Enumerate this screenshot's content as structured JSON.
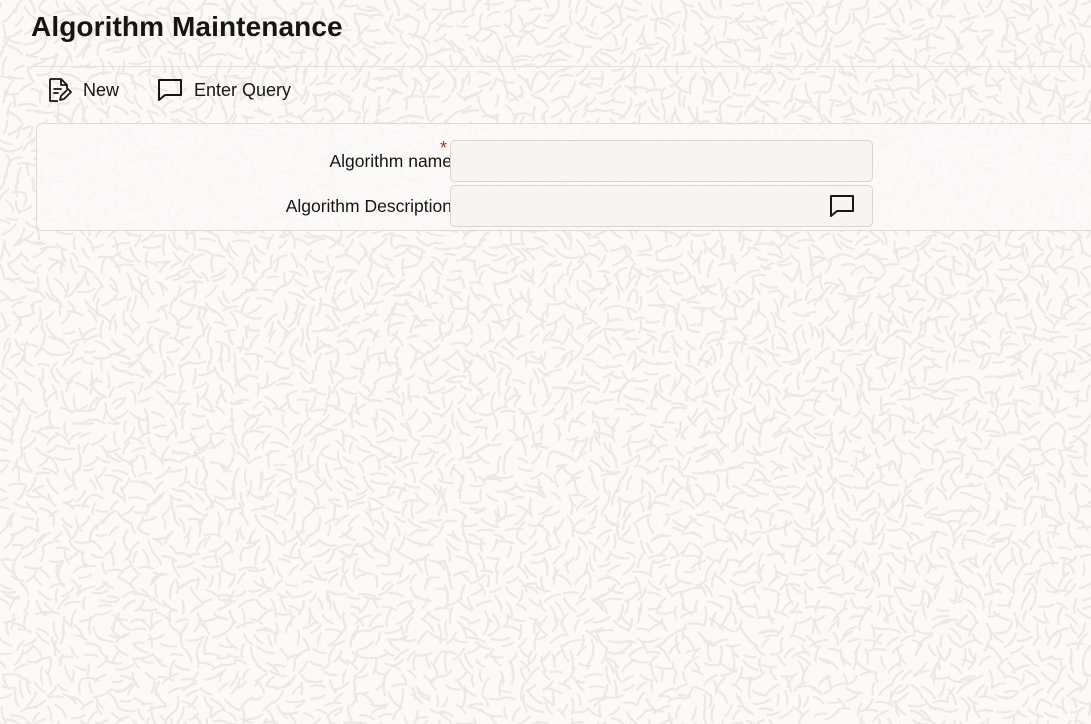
{
  "page": {
    "title": "Algorithm Maintenance"
  },
  "toolbar": {
    "new_label": "New",
    "new_icon": "new-document-icon",
    "enter_query_label": "Enter Query",
    "enter_query_icon": "chat-bubble-icon"
  },
  "form": {
    "algorithm_name": {
      "label": "Algorithm name",
      "required_mark": "*",
      "value": ""
    },
    "algorithm_description": {
      "label": "Algorithm Description",
      "value": "",
      "icon": "chat-bubble-icon"
    }
  },
  "colors": {
    "background": "#fbfaf9",
    "text": "#161513",
    "required": "#b42f1e",
    "border": "#dedad4"
  }
}
